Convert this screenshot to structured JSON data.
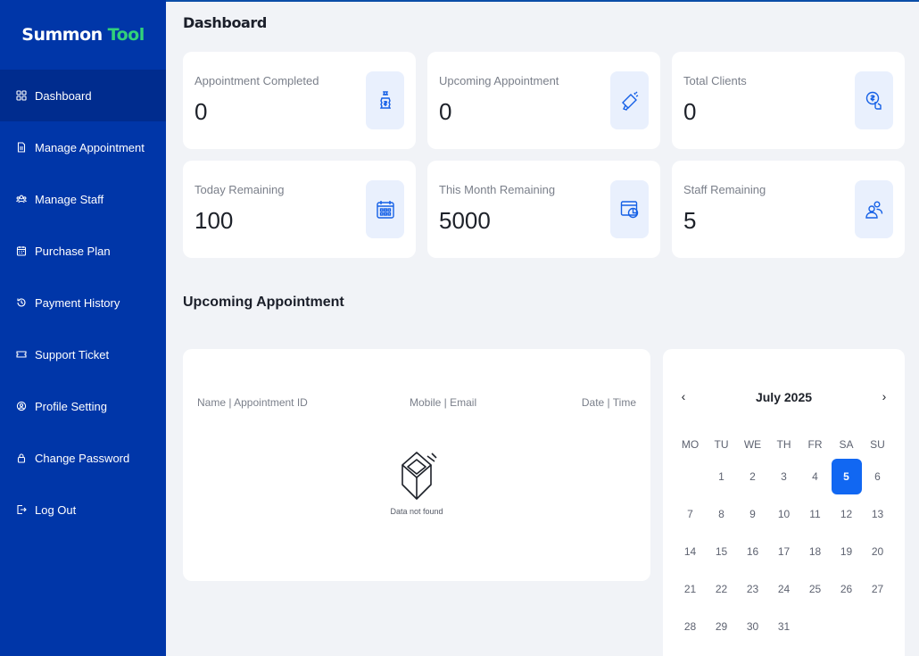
{
  "brand": {
    "part1": "Summon",
    "part2": "Tool"
  },
  "sidebar": {
    "items": [
      {
        "label": "Dashboard",
        "icon": "grid-icon",
        "active": true
      },
      {
        "label": "Manage Appointment",
        "icon": "document-icon"
      },
      {
        "label": "Manage Staff",
        "icon": "users-icon"
      },
      {
        "label": "Purchase Plan",
        "icon": "calendar-icon"
      },
      {
        "label": "Payment History",
        "icon": "history-icon"
      },
      {
        "label": "Support Ticket",
        "icon": "ticket-icon"
      },
      {
        "label": "Profile Setting",
        "icon": "settings-icon"
      },
      {
        "label": "Change Password",
        "icon": "lock-icon"
      },
      {
        "label": "Log Out",
        "icon": "logout-icon"
      }
    ]
  },
  "header": {
    "title": "Dashboard"
  },
  "stats": [
    {
      "label": "Appointment Completed",
      "value": "0",
      "icon": "money-bag-icon"
    },
    {
      "label": "Upcoming Appointment",
      "value": "0",
      "icon": "megaphone-icon"
    },
    {
      "label": "Total Clients",
      "value": "0",
      "icon": "coin-hand-icon"
    },
    {
      "label": "Today Remaining",
      "value": "100",
      "icon": "calendar-grid-icon"
    },
    {
      "label": "This Month Remaining",
      "value": "5000",
      "icon": "browser-chart-icon"
    },
    {
      "label": "Staff Remaining",
      "value": "5",
      "icon": "people-icon"
    }
  ],
  "upcoming": {
    "title": "Upcoming Appointment",
    "columns": [
      "Name | Appointment ID",
      "Mobile | Email",
      "Date | Time"
    ],
    "empty_text": "Data not found"
  },
  "calendar": {
    "month_label": "July 2025",
    "prev": "‹",
    "next": "›",
    "weekdays": [
      "MO",
      "TU",
      "WE",
      "TH",
      "FR",
      "SA",
      "SU"
    ],
    "start_offset": 1,
    "days_in_month": 31,
    "selected_day": 5
  },
  "colors": {
    "sidebar": "#0036a8",
    "sidebar_active": "#002c8e",
    "brand_accent": "#32d17a",
    "accent": "#1167f2",
    "icon_bg": "#e9f0fd",
    "icon_stroke": "#1560e6"
  }
}
